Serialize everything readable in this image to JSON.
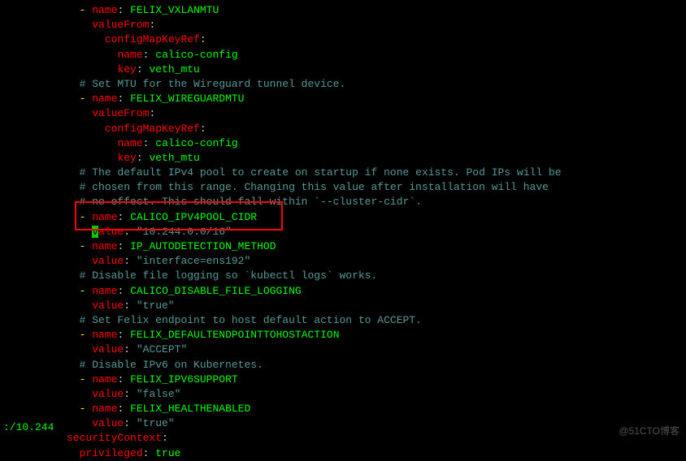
{
  "indent": {
    "l0": "            ",
    "l1": "              ",
    "l2": "                ",
    "l3": "                  "
  },
  "tokens": {
    "dash": "- ",
    "name": "name",
    "value": "value",
    "valueFrom": "valueFrom",
    "configMapKeyRef": "configMapKeyRef",
    "key": "key",
    "securityContext": "securityContext",
    "privileged": "privileged",
    "colon": ":",
    "colon_sp": ": ",
    "true": "true"
  },
  "env": {
    "vxlanmtu": "FELIX_VXLANMTU",
    "wireguardmtu": "FELIX_WIREGUARDMTU",
    "ipv4pool_cidr": "CALICO_IPV4POOL_CIDR",
    "ip_autodetect": "IP_AUTODETECTION_METHOD",
    "disable_file_logging": "CALICO_DISABLE_FILE_LOGGING",
    "default_ep_action": "FELIX_DEFAULTENDPOINTTOHOSTACTION",
    "ipv6support": "FELIX_IPV6SUPPORT",
    "healthenabled": "FELIX_HEALTHENABLED"
  },
  "strings": {
    "calico_config": "calico-config",
    "veth_mtu": "veth_mtu",
    "cidr": "\"10.244.0.0/16\"",
    "iface": "\"interface=ens192\"",
    "true_q": "\"true\"",
    "false_q": "\"false\"",
    "accept": "\"ACCEPT\""
  },
  "comments": {
    "mtu_wireguard": "# Set MTU for the Wireguard tunnel device.",
    "ipv4pool_1": "# The default IPv4 pool to create on startup if none exists. Pod IPs will be",
    "ipv4pool_2": "# chosen from this range. Changing this value after installation will have",
    "ipv4pool_3": "# no effect. This should fall within `--cluster-cidr`.",
    "disable_logging": "# Disable file logging so `kubectl logs` works.",
    "felix_ep": "# Set Felix endpoint to host default action to ACCEPT.",
    "ipv6": "# Disable IPv6 on Kubernetes."
  },
  "cursor_char": "v",
  "value_rest": "alue",
  "statusline": ":/10.244",
  "watermark": "@51CTO博客"
}
